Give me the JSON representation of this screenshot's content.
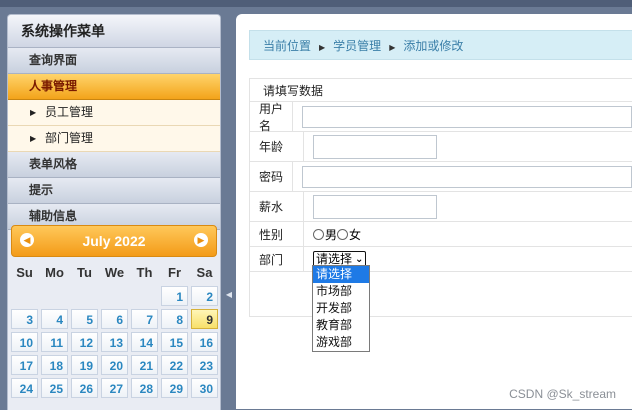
{
  "sidebar": {
    "title": "系统操作菜单",
    "items": [
      {
        "label": "查询界面"
      },
      {
        "label": "人事管理",
        "active": true
      },
      {
        "label": "员工管理",
        "sub": true
      },
      {
        "label": "部门管理",
        "sub": true
      },
      {
        "label": "表单风格"
      },
      {
        "label": "提示"
      },
      {
        "label": "辅助信息"
      }
    ]
  },
  "calendar": {
    "month": "July 2022",
    "prev_icon": "chevron-left-icon",
    "next_icon": "chevron-right-icon",
    "weekdays": [
      "Su",
      "Mo",
      "Tu",
      "We",
      "Th",
      "Fr",
      "Sa"
    ],
    "days": [
      "",
      "",
      "",
      "",
      "",
      "1",
      "2",
      "3",
      "4",
      "5",
      "6",
      "7",
      "8",
      "9",
      "10",
      "11",
      "12",
      "13",
      "14",
      "15",
      "16",
      "17",
      "18",
      "19",
      "20",
      "21",
      "22",
      "23",
      "24",
      "25",
      "26",
      "27",
      "28",
      "29",
      "30"
    ],
    "today": "9"
  },
  "breadcrumb": [
    "当前位置",
    "学员管理",
    "添加或修改"
  ],
  "form": {
    "title": "请填写数据",
    "username_label": "用户名",
    "age_label": "年龄",
    "password_label": "密码",
    "salary_label": "薪水",
    "gender_label": "性别",
    "male": "男",
    "female": "女",
    "dept_label": "部门",
    "dept_selected": "请选择"
  },
  "dropdown_options": [
    "请选择",
    "市场部",
    "开发部",
    "教育部",
    "游戏部"
  ],
  "watermark": "CSDN @Sk_stream",
  "colors": {
    "accent": "#f3a31a",
    "link": "#2a87c0",
    "highlight": "#1e7ae6"
  }
}
